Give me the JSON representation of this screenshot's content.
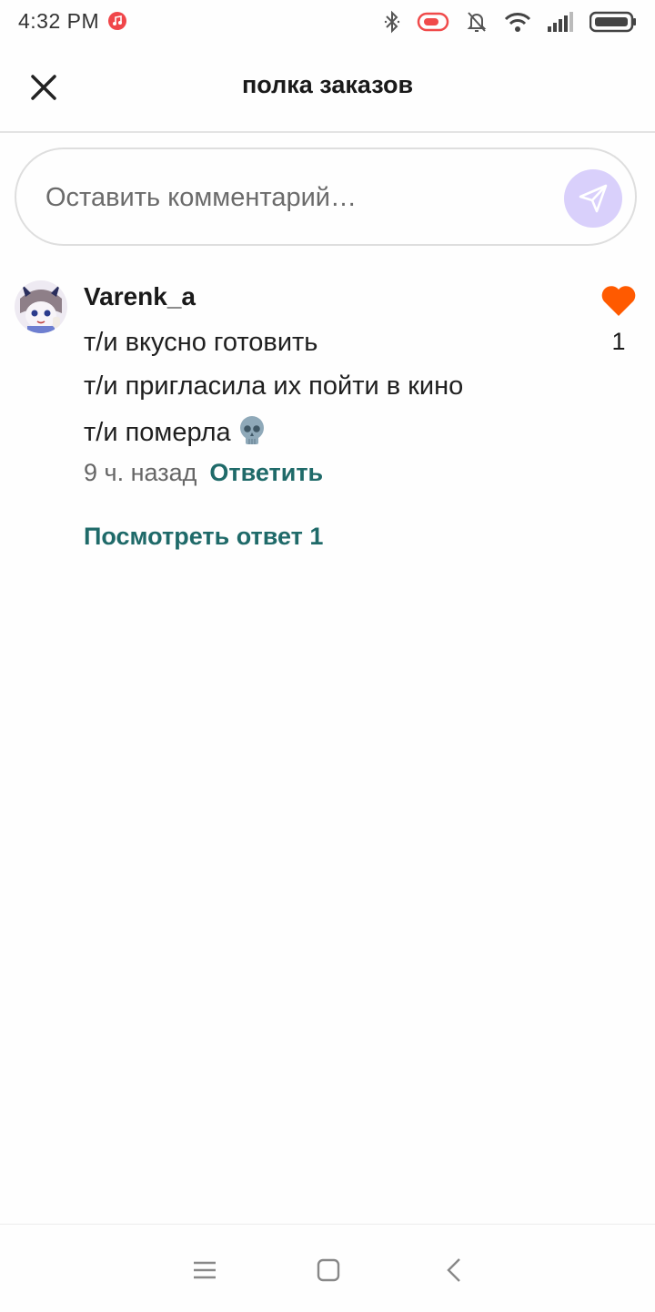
{
  "status_bar": {
    "time": "4:32 PM",
    "icons": [
      "music-icon",
      "bluetooth-icon",
      "alarm-icon",
      "mute-icon",
      "wifi-icon",
      "signal-icon",
      "battery-icon"
    ]
  },
  "header": {
    "title": "полка заказов",
    "close_icon": "close-icon"
  },
  "comment_input": {
    "placeholder": "Оставить комментарий…",
    "send_icon": "send-icon"
  },
  "comments": [
    {
      "author": "Varenk_a",
      "lines": [
        "т/и вкусно готовить",
        "т/и пригласила их пойти в кино",
        "т/и померла"
      ],
      "emoji": "skull-icon",
      "time": "9 ч. назад",
      "reply_label": "Ответить",
      "likes": "1",
      "view_replies_label": "Посмотреть ответ 1"
    }
  ],
  "colors": {
    "accent": "#1f6a69",
    "like": "#ff5a00",
    "send_button": "#d9d0fb"
  },
  "nav_bar": {
    "icons": [
      "menu-icon",
      "home-icon",
      "back-icon"
    ]
  }
}
